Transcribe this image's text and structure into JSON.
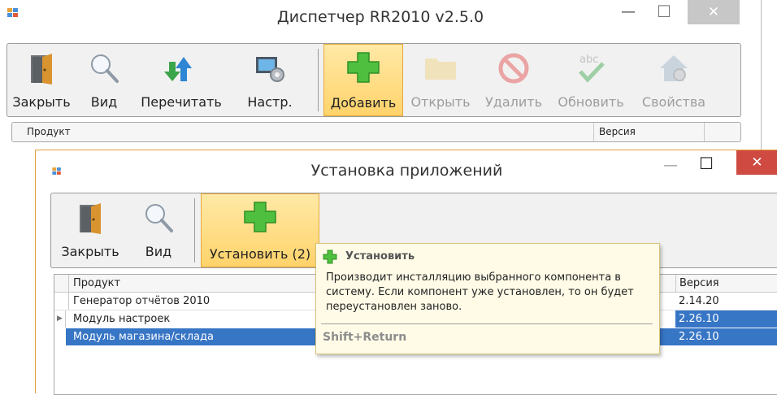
{
  "main_window": {
    "title": "Диспетчер RR2010 v2.5.0",
    "minimize": "—",
    "maximize": "☐",
    "close": "✕",
    "toolbar": [
      {
        "label": "Закрыть",
        "icon": "door-exit-icon",
        "enabled": true
      },
      {
        "label": "Вид",
        "icon": "magnifier-icon",
        "enabled": true
      },
      {
        "label": "Перечитать",
        "icon": "refresh-arrows-icon",
        "enabled": true
      },
      {
        "label": "Настр.",
        "icon": "settings-monitor-icon",
        "enabled": true
      },
      {
        "label": "Добавить",
        "icon": "plus-icon",
        "enabled": true,
        "active": true
      },
      {
        "label": "Открыть",
        "icon": "folder-icon",
        "enabled": false
      },
      {
        "label": "Удалить",
        "icon": "forbidden-icon",
        "enabled": false
      },
      {
        "label": "Обновить",
        "icon": "abc-check-icon",
        "enabled": false
      },
      {
        "label": "Свойства",
        "icon": "house-gear-icon",
        "enabled": false
      }
    ],
    "grid_headers": {
      "product": "Продукт",
      "version": "Версия"
    }
  },
  "dialog": {
    "title": "Установка приложений",
    "minimize": "—",
    "maximize": "☐",
    "close": "✕",
    "toolbar": [
      {
        "label": "Закрыть",
        "icon": "door-exit-icon"
      },
      {
        "label": "Вид",
        "icon": "magnifier-icon"
      },
      {
        "label": "Установить (2)",
        "icon": "plus-icon",
        "active": true
      }
    ],
    "grid": {
      "headers": {
        "product": "Продукт",
        "version": "Версия"
      },
      "rows": [
        {
          "product": "Генератор отчётов 2010",
          "version": "2.14.20",
          "selected": false,
          "current": false
        },
        {
          "product": "Модуль настроек",
          "version": "2.26.10",
          "selected": true,
          "current": true
        },
        {
          "product": "Модуль магазина/склада",
          "version": "2.26.10",
          "selected": true,
          "current": false
        }
      ]
    }
  },
  "tooltip": {
    "title": "Установить",
    "body": "Производит инсталляцию выбранного компонента в систему. Если компонент уже установлен, то он будет переустановлен заново.",
    "shortcut": "Shift+Return"
  },
  "colors": {
    "accent_active": "#ffd36b",
    "selection": "#3775c5",
    "close_red": "#cf4b41",
    "tooltip_bg": "#fffbe7"
  }
}
